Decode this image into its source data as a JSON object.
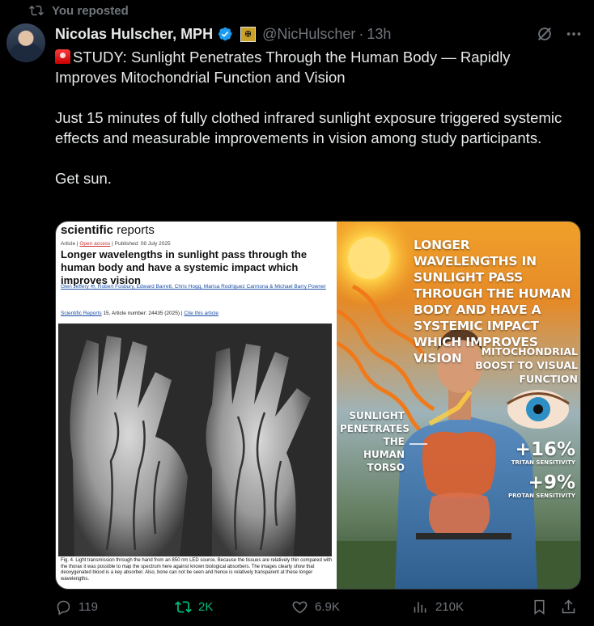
{
  "repost_context": {
    "text": "You reposted"
  },
  "author": {
    "name": "Nicolas Hulscher, MPH",
    "handle": "@NicHulscher",
    "separator": "·",
    "time": "13h"
  },
  "tweet": {
    "headline": "STUDY: Sunlight Penetrates Through the Human Body — Rapidly Improves Mitochondrial Function and Vision",
    "paragraph2": "Just 15 minutes of fully clothed infrared sunlight exposure triggered systemic effects and measurable improvements in vision among study participants.",
    "paragraph3": "Get sun."
  },
  "paper": {
    "journal_bold": "scientific",
    "journal_rest": " reports",
    "meta_article": "Article",
    "meta_open_access": "Open access",
    "meta_published": "Published: 08 July 2025",
    "title": "Longer wavelengths in sunlight pass through the human body and have a systemic impact which improves vision",
    "authors": "Glen Jeffery ✉, Robert Fosbury, Edward Barrett, Chris Hogg, Marisa Rodriguez Carmona & Michael Barry Powner",
    "cite_journal": "Scientific Reports",
    "cite_rest": " 15, Article number: 24435 (2025) | ",
    "cite_link": "Cite this article",
    "caption": "Fig. 4. Light transmission through the hand from an 850 nm LED source. Because the tissues are relatively thin compared with the thorax it was possible to map the spectrum here against known biological absorbers. The images clearly show that deoxygenated blood is a key absorber. Also, bone can not be seen and hence is relatively transparent at these longer wavelengths."
  },
  "infographic": {
    "title": "LONGER WAVELENGTHS IN SUNLIGHT PASS THROUGH THE HUMAN BODY AND HAVE A SYSTEMIC IMPACT WHICH IMPROVES VISION",
    "mito": "MITOCHONDRIAL BOOST TO VISUAL FUNCTION",
    "penetrates": "SUNLIGHT PENETRATES THE HUMAN TORSO",
    "stat1_value": "+16%",
    "stat1_label": "TRITAN SENSITIVITY",
    "stat2_value": "+9%",
    "stat2_label": "PROTAN SENSITIVITY"
  },
  "actions": {
    "replies": "119",
    "reposts": "2K",
    "likes": "6.9K",
    "views": "210K"
  },
  "colors": {
    "accent_repost": "#00ba7c",
    "muted": "#71767b",
    "text": "#e7e9ea",
    "verified": "#1d9bf0"
  }
}
